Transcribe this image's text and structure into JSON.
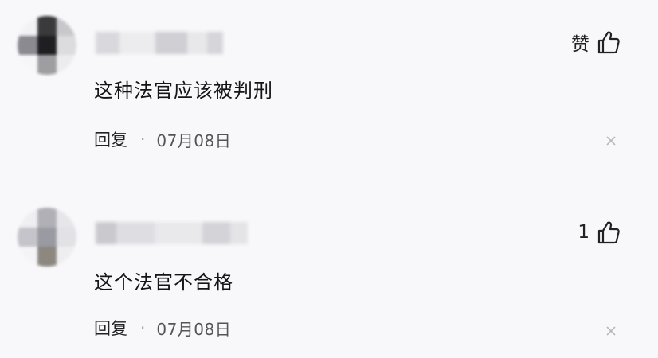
{
  "comments": [
    {
      "like_label": "赞",
      "text": "这种法官应该被判刑",
      "reply_label": "回复",
      "separator": "·",
      "date": "07月08日",
      "avatar_colors": [
        "#f2f2f4",
        "#3a3a3c",
        "#c8c8cc",
        "#8a8a90",
        "#1f1f22",
        "#dcdcdf",
        "#f6f6f8",
        "#9d9da2",
        "#ececef"
      ],
      "username_colors": [
        "#d9d9dd",
        "#ececef",
        "#cfcfd4",
        "#e8e8eb",
        "#d6d6da"
      ]
    },
    {
      "like_label": "1",
      "text": "这个法官不合格",
      "reply_label": "回复",
      "separator": "·",
      "date": "07月08日",
      "avatar_colors": [
        "#efeff2",
        "#b0b0b6",
        "#e6e6ea",
        "#c4c4ca",
        "#9a9aa2",
        "#e2e2e6",
        "#f4f4f6",
        "#8c8880",
        "#eeeef1"
      ],
      "username_colors": [
        "#c9c9ce",
        "#dedee2",
        "#e9e9ec",
        "#d3d3d8",
        "#e4e4e7"
      ]
    }
  ]
}
